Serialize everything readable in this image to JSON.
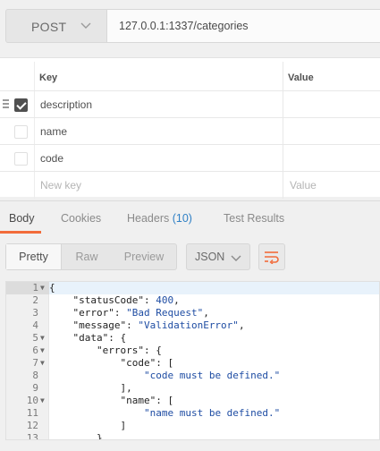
{
  "request": {
    "method": "POST",
    "url": "127.0.0.1:1337/categories"
  },
  "params": {
    "header_key": "Key",
    "header_value": "Value",
    "rows": [
      {
        "key": "description",
        "checked": true
      },
      {
        "key": "name",
        "checked": false
      },
      {
        "key": "code",
        "checked": false
      }
    ],
    "new_key_placeholder": "New key",
    "new_value_placeholder": "Value"
  },
  "response_tabs": {
    "body": "Body",
    "cookies": "Cookies",
    "headers": "Headers",
    "headers_count": "(10)",
    "test_results": "Test Results"
  },
  "toolbar": {
    "pretty": "Pretty",
    "raw": "Raw",
    "preview": "Preview",
    "format": "JSON"
  },
  "editor": {
    "lines": [
      {
        "n": "1",
        "fold": true,
        "text": "{"
      },
      {
        "n": "2",
        "fold": false,
        "text": "    \"statusCode\": 400,"
      },
      {
        "n": "3",
        "fold": false,
        "text": "    \"error\": \"Bad Request\","
      },
      {
        "n": "4",
        "fold": false,
        "text": "    \"message\": \"ValidationError\","
      },
      {
        "n": "5",
        "fold": true,
        "text": "    \"data\": {"
      },
      {
        "n": "6",
        "fold": true,
        "text": "        \"errors\": {"
      },
      {
        "n": "7",
        "fold": true,
        "text": "            \"code\": ["
      },
      {
        "n": "8",
        "fold": false,
        "text": "                \"code must be defined.\""
      },
      {
        "n": "9",
        "fold": false,
        "text": "            ],"
      },
      {
        "n": "10",
        "fold": true,
        "text": "            \"name\": ["
      },
      {
        "n": "11",
        "fold": false,
        "text": "                \"name must be defined.\""
      },
      {
        "n": "12",
        "fold": false,
        "text": "            ]"
      },
      {
        "n": "13",
        "fold": false,
        "text": "        }"
      }
    ]
  },
  "colors": {
    "accent": "#f26b3a",
    "link": "#2f80c5",
    "json_string": "#1f4da3"
  }
}
